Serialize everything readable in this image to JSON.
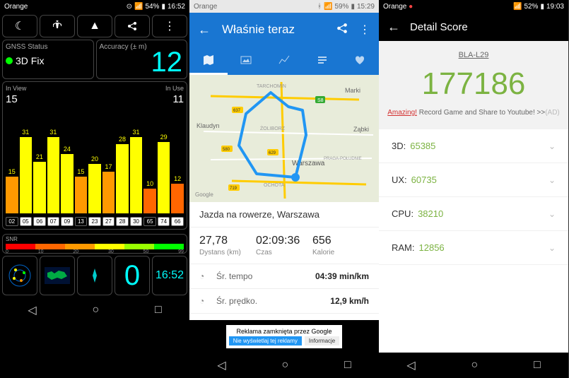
{
  "phone1": {
    "status": {
      "carrier": "Orange",
      "battery": "54%",
      "time": "16:52"
    },
    "gnss": {
      "label": "GNSS Status",
      "value": "3D Fix"
    },
    "accuracy": {
      "label": "Accuracy (± m)",
      "value": "12"
    },
    "sats": {
      "inview_lbl": "In View",
      "inview": "15",
      "inuse_lbl": "In Use",
      "inuse": "11",
      "bars": [
        {
          "prn": "02",
          "snr": 15,
          "used": false,
          "color": "#f90"
        },
        {
          "prn": "05",
          "snr": 31,
          "used": true,
          "color": "#ff0"
        },
        {
          "prn": "06",
          "snr": 21,
          "used": true,
          "color": "#ff0"
        },
        {
          "prn": "07",
          "snr": 31,
          "used": true,
          "color": "#ff0"
        },
        {
          "prn": "09",
          "snr": 24,
          "used": true,
          "color": "#ff0"
        },
        {
          "prn": "13",
          "snr": 15,
          "used": false,
          "color": "#f90"
        },
        {
          "prn": "23",
          "snr": 20,
          "used": true,
          "color": "#ff0"
        },
        {
          "prn": "27",
          "snr": 17,
          "used": true,
          "color": "#f90"
        },
        {
          "prn": "28",
          "snr": 28,
          "used": true,
          "color": "#ff0"
        },
        {
          "prn": "30",
          "snr": 31,
          "used": true,
          "color": "#ff0"
        },
        {
          "prn": "65",
          "snr": 10,
          "used": false,
          "color": "#f60"
        },
        {
          "prn": "74",
          "snr": 29,
          "used": true,
          "color": "#ff0"
        },
        {
          "prn": "66",
          "snr": 12,
          "used": true,
          "color": "#f60"
        }
      ]
    },
    "snr": {
      "label": "SNR",
      "ticks": [
        "0",
        "10",
        "20",
        "30",
        "50",
        "99"
      ],
      "colors": [
        "#f00",
        "#f60",
        "#f90",
        "#ff0",
        "#9f0",
        "#0f0"
      ]
    },
    "bottom": {
      "count": "0",
      "time": "16:52"
    }
  },
  "phone2": {
    "status": {
      "carrier": "Orange",
      "battery": "59%",
      "time": "15:29"
    },
    "title": "Właśnie teraz",
    "activity": "Jazda na rowerze, Warszawa",
    "stats": [
      {
        "v": "27,78",
        "l": "Dystans (km)"
      },
      {
        "v": "02:09:36",
        "l": "Czas"
      },
      {
        "v": "656",
        "l": "Kalorie"
      }
    ],
    "rows": [
      {
        "lbl": "Śr. tempo",
        "val": "04:39 min/km"
      },
      {
        "lbl": "Śr. prędko.",
        "val": "12,9 km/h"
      }
    ],
    "ad": {
      "txt": "Reklama zamknięta przez Google",
      "b1": "Nie wyświetlaj tej reklamy",
      "b2": "Informacje"
    },
    "map_labels": [
      "Marki",
      "TARCHOMIN",
      "Ząbki",
      "Klaudyn",
      "ŻOLIBORZ",
      "Warszawa",
      "PRAGA-POŁUDNIE",
      "OCHOTA",
      "Google"
    ],
    "map_roads": [
      "S8",
      "637",
      "580",
      "629",
      "719"
    ]
  },
  "phone3": {
    "status": {
      "carrier": "Orange",
      "battery": "52%",
      "time": "19:03"
    },
    "title": "Detail Score",
    "device": "BLA-L29",
    "score": "177186",
    "promo_red": "Amazing!",
    "promo": " Record Game and Share to Youtube! >>",
    "promo_ad": "(AD)",
    "cats": [
      {
        "lbl": "3D:",
        "val": "65385"
      },
      {
        "lbl": "UX:",
        "val": "60735"
      },
      {
        "lbl": "CPU:",
        "val": "38210"
      },
      {
        "lbl": "RAM:",
        "val": "12856"
      }
    ]
  }
}
